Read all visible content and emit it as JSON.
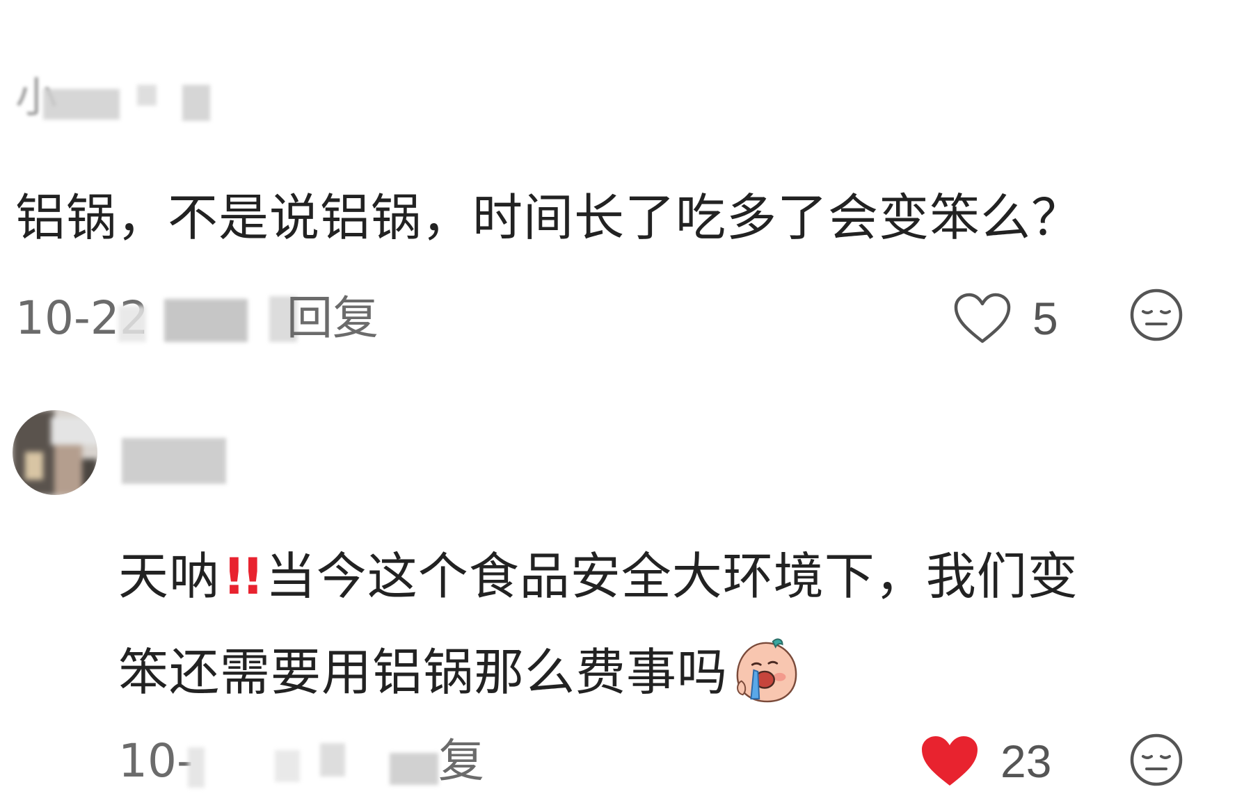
{
  "comments": [
    {
      "username_partial": "小",
      "text": "铝锅，不是说铝锅，时间长了吃多了会变笨么？",
      "date_partial": "10-22",
      "reply_label": "回复",
      "likes": "5",
      "liked": false,
      "like_icon": "heart-outline-icon",
      "dislike_icon": "neutral-face-icon"
    },
    {
      "line1_before": "天呐",
      "emphasis_glyph": "!!",
      "line1_after": "当今这个食品安全大环境下，我们变",
      "line2": "笨还需要用铝锅那么费事吗",
      "emoji_icon": "crying-face-icon",
      "date_partial": "10-",
      "reply_label": "复",
      "likes": "23",
      "liked": true,
      "like_icon": "heart-filled-icon",
      "dislike_icon": "neutral-face-icon"
    }
  ],
  "colors": {
    "text": "#222222",
    "meta": "#6b6b6b",
    "like_red": "#e8232f",
    "icon_gray": "#555555"
  }
}
